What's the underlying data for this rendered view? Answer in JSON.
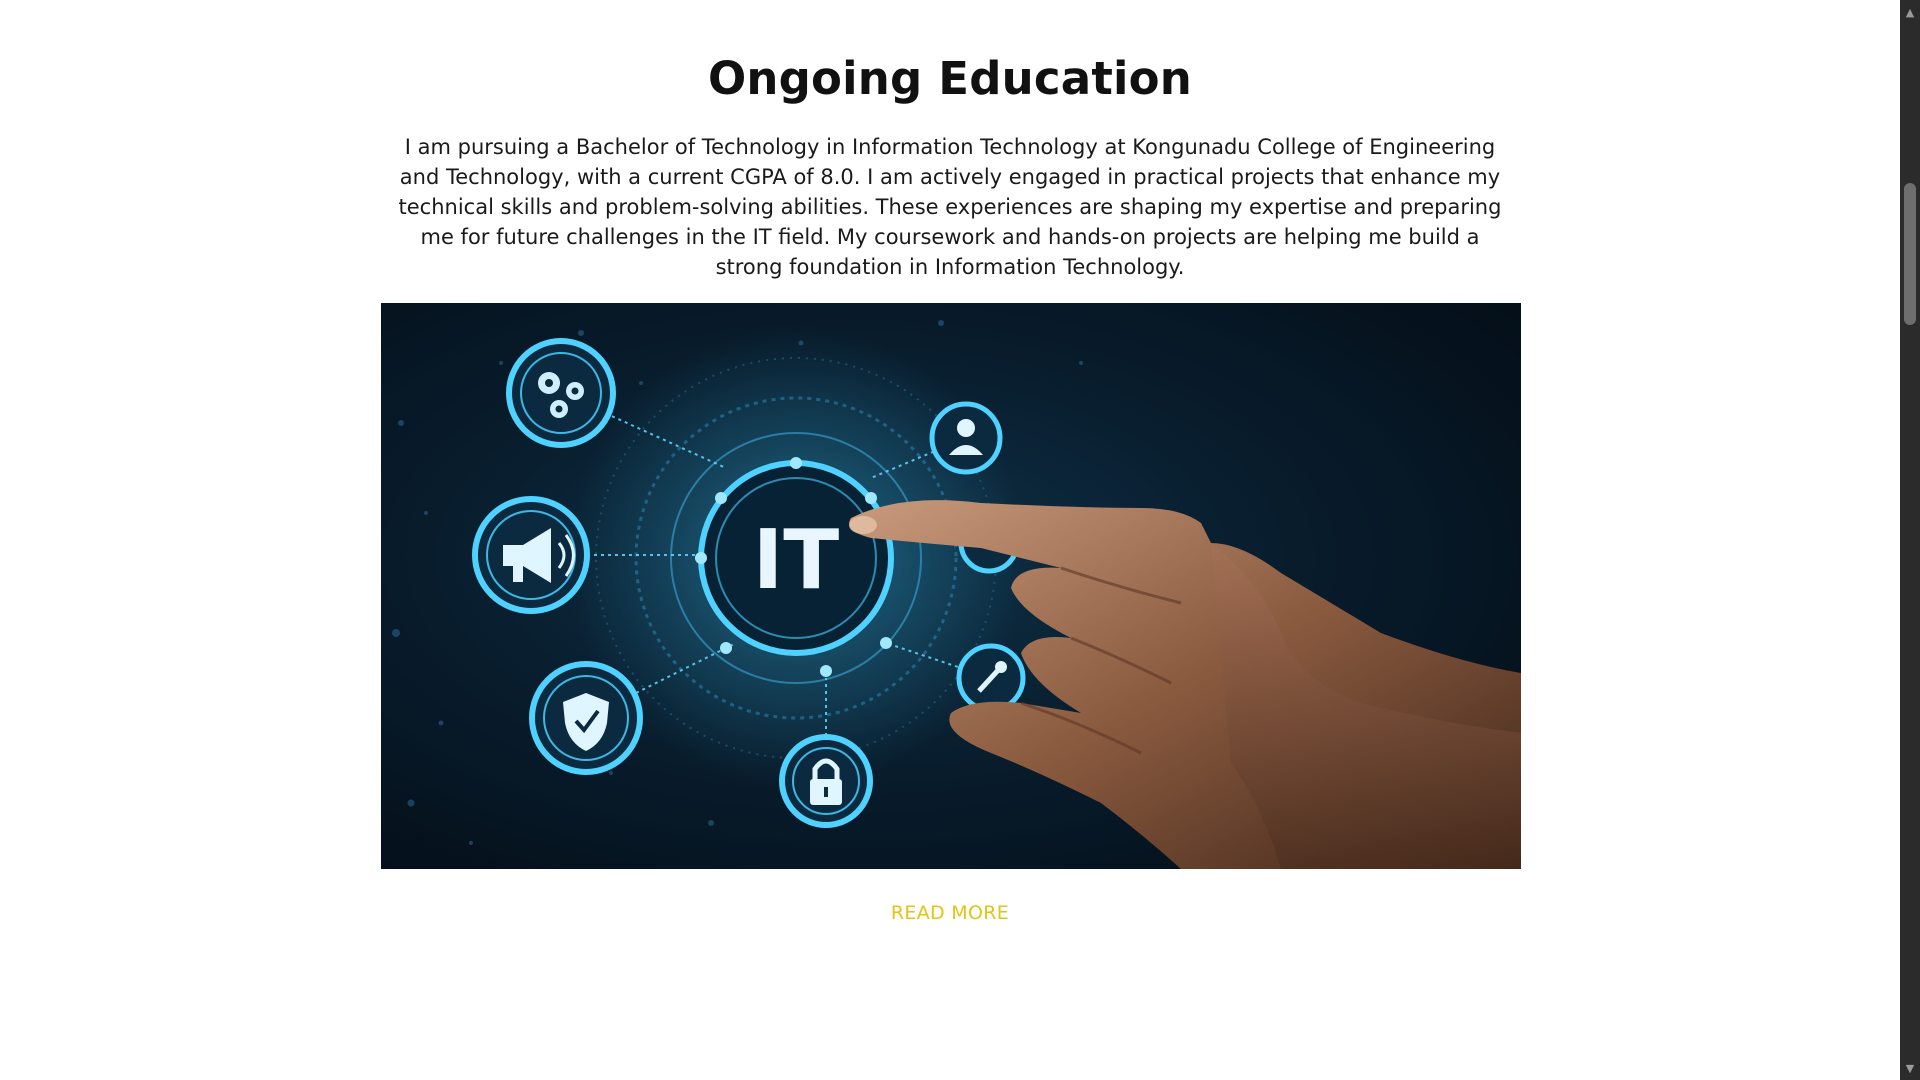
{
  "section": {
    "title": "Ongoing Education",
    "description": "I am pursuing a Bachelor of Technology in Information Technology at Kongunadu College of Engineering and Technology, with a current CGPA of 8.0. I am actively engaged in practical projects that enhance my technical skills and problem-solving abilities. These experiences are shaping my expertise and preparing me for future challenges in the IT field. My coursework and hands-on projects are helping me build a strong foundation in Information Technology.",
    "read_more_label": "READ MORE",
    "read_more_color": "#e3c414"
  },
  "image": {
    "center_text": "IT",
    "icons": [
      "gears-icon",
      "megaphone-icon",
      "shield-check-icon",
      "lock-icon",
      "user-icon",
      "tools-icon"
    ]
  },
  "scrollbar": {
    "up_arrow": "▲",
    "down_arrow": "▼"
  }
}
